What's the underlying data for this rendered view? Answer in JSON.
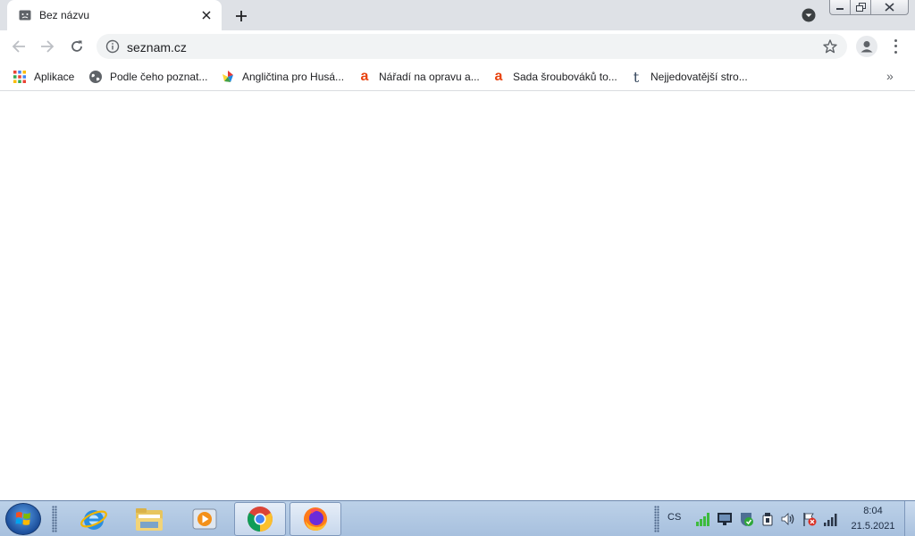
{
  "browser": {
    "tab": {
      "title": "Bez názvu"
    },
    "omnibox": {
      "url": "seznam.cz"
    }
  },
  "bookmarks": [
    {
      "label": "Aplikace",
      "icon": "apps-grid-icon"
    },
    {
      "label": "Podle čeho poznat...",
      "icon": "globe-icon"
    },
    {
      "label": "Angličtina pro Husá...",
      "icon": "colorful-logo-icon"
    },
    {
      "label": "Nářadí na opravu a...",
      "icon": "letter-a-icon"
    },
    {
      "label": "Sada šroubováků to...",
      "icon": "letter-a-icon"
    },
    {
      "label": "Nejjedovatější stro...",
      "icon": "letter-t-icon"
    }
  ],
  "bookmarks_more": "»",
  "taskbar": {
    "pinned": [
      {
        "name": "internet-explorer-icon"
      },
      {
        "name": "file-explorer-icon"
      },
      {
        "name": "media-player-icon"
      },
      {
        "name": "chrome-icon",
        "active": true
      },
      {
        "name": "firefox-icon",
        "active": true
      }
    ],
    "language": "CS",
    "clock": {
      "time": "8:04",
      "date": "21.5.2021"
    }
  },
  "colors": {
    "tabstrip": "#dee1e6",
    "taskbar": "#a7c0de",
    "bookmark_a": "#e8420f",
    "bookmark_t": "#35465c"
  }
}
